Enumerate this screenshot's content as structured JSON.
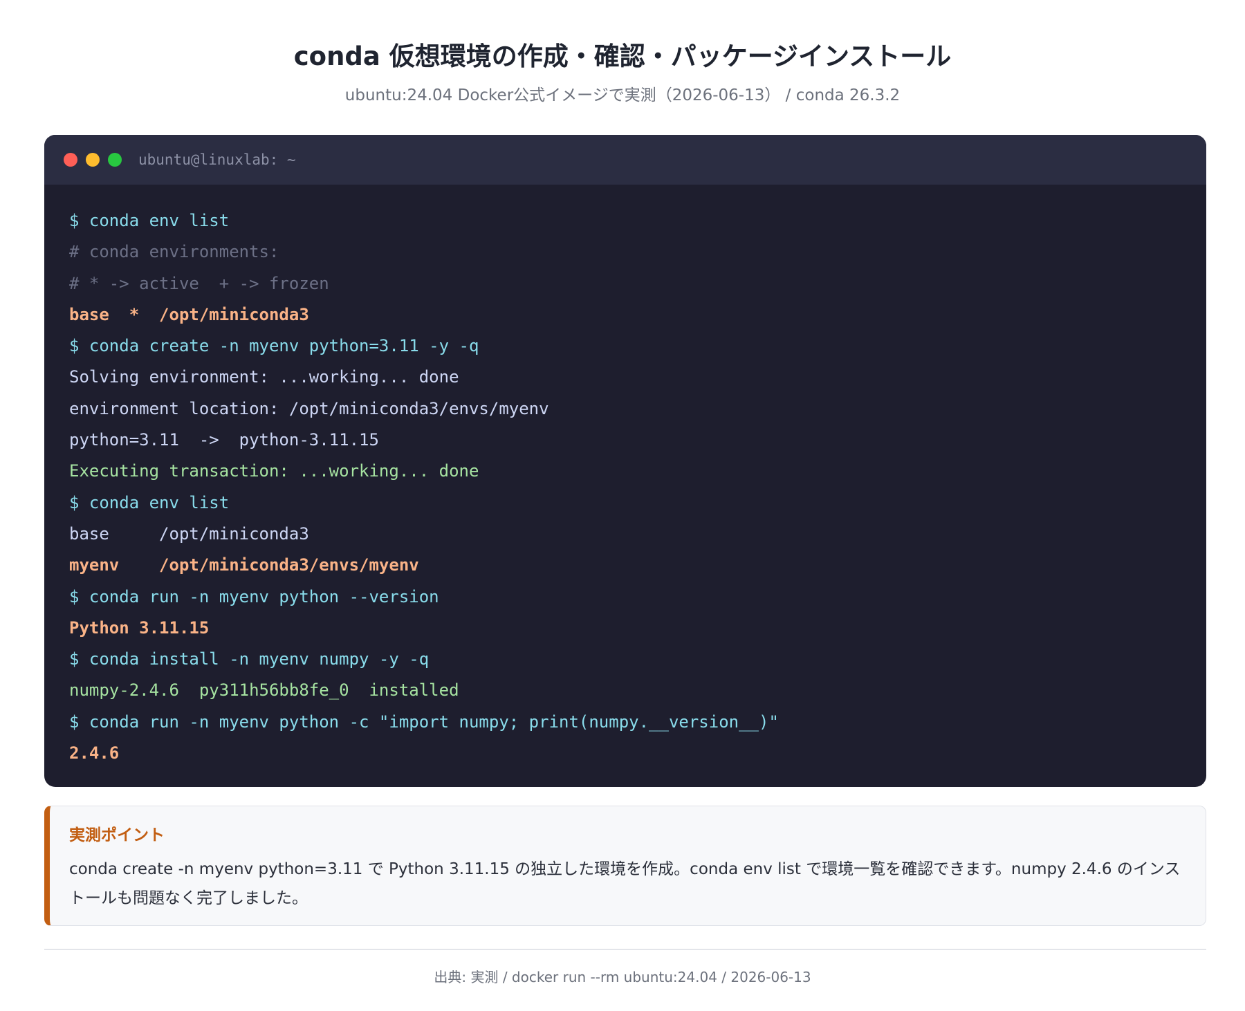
{
  "header": {
    "title": "conda 仮想環境の作成・確認・パッケージインストール",
    "subtitle": "ubuntu:24.04 Docker公式イメージで実測（2026-06-13） / conda 26.3.2"
  },
  "terminal": {
    "window_title": "ubuntu@linuxlab: ~",
    "lines": [
      {
        "kind": "cmd",
        "text": "$ conda env list"
      },
      {
        "kind": "comment",
        "text": "# conda environments:"
      },
      {
        "kind": "comment",
        "text": "# * -> active  + -> frozen"
      },
      {
        "kind": "hl",
        "text": "base  *  /opt/miniconda3"
      },
      {
        "kind": "cmd",
        "text": "$ conda create -n myenv python=3.11 -y -q"
      },
      {
        "kind": "out",
        "text": "Solving environment: ...working... done"
      },
      {
        "kind": "out",
        "text": "environment location: /opt/miniconda3/envs/myenv"
      },
      {
        "kind": "out",
        "text": "python=3.11  ->  python-3.11.15"
      },
      {
        "kind": "ok",
        "text": "Executing transaction: ...working... done"
      },
      {
        "kind": "cmd",
        "text": "$ conda env list"
      },
      {
        "kind": "out",
        "text": "base     /opt/miniconda3"
      },
      {
        "kind": "hl",
        "text": "myenv    /opt/miniconda3/envs/myenv"
      },
      {
        "kind": "cmd",
        "text": "$ conda run -n myenv python --version"
      },
      {
        "kind": "hl",
        "text": "Python 3.11.15"
      },
      {
        "kind": "cmd",
        "text": "$ conda install -n myenv numpy -y -q"
      },
      {
        "kind": "ok",
        "text": "numpy-2.4.6  py311h56bb8fe_0  installed"
      },
      {
        "kind": "cmd",
        "text": "$ conda run -n myenv python -c \"import numpy; print(numpy.__version__)\""
      },
      {
        "kind": "hl",
        "text": "2.4.6"
      }
    ]
  },
  "note": {
    "title": "実測ポイント",
    "text": "conda create -n myenv python=3.11 で Python 3.11.15 の独立した環境を作成。conda env list で環境一覧を確認できます。numpy 2.4.6 のインストールも問題なく完了しました。"
  },
  "footer": {
    "text": "出典: 実測 / docker run --rm ubuntu:24.04 / 2026-06-13"
  },
  "colors": {
    "terminal_bg": "#1e1e2e",
    "terminal_bar": "#2b2d42",
    "command": "#89dceb",
    "comment": "#6c7086",
    "highlight": "#fab387",
    "output": "#cdd6f4",
    "success": "#a6e3a1",
    "accent": "#c25e12"
  }
}
